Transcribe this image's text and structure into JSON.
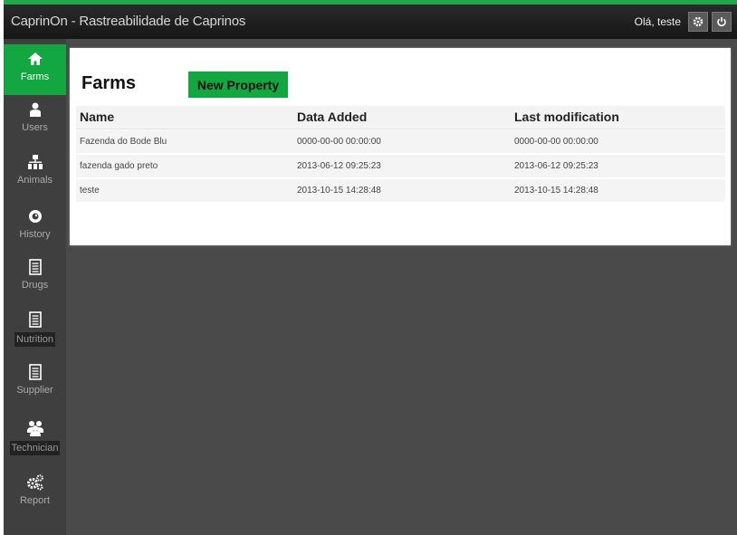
{
  "header": {
    "title": "CaprinOn - Rastreabilidade de Caprinos",
    "greeting": "Olá, teste"
  },
  "sidebar": {
    "items": [
      {
        "label": "Farms",
        "icon": "home-icon"
      },
      {
        "label": "Users",
        "icon": "user-icon"
      },
      {
        "label": "Animals",
        "icon": "sitemap-icon"
      },
      {
        "label": "History",
        "icon": "eye-icon"
      },
      {
        "label": "Drugs",
        "icon": "document-icon"
      },
      {
        "label": "Nutrition",
        "icon": "document-icon"
      },
      {
        "label": "Supplier",
        "icon": "document-icon"
      },
      {
        "label": "Technician",
        "icon": "group-icon"
      },
      {
        "label": "Report",
        "icon": "gears-icon"
      }
    ]
  },
  "main": {
    "title": "Farms",
    "new_button": "New Property",
    "columns": [
      "Name",
      "Data Added",
      "Last modification"
    ],
    "rows": [
      [
        "Fazenda do Bode Blu",
        "0000-00-00 00:00:00",
        "0000-00-00 00:00:00"
      ],
      [
        "fazenda gado preto",
        "2013-06-12 09:25:23",
        "2013-06-12 09:25:23"
      ],
      [
        "teste",
        "2013-10-15 14:28:48",
        "2013-10-15 14:28:48"
      ]
    ]
  },
  "colors": {
    "accent": "#12a740",
    "background": "#4a4a4a",
    "header": "#1c1c1c"
  }
}
